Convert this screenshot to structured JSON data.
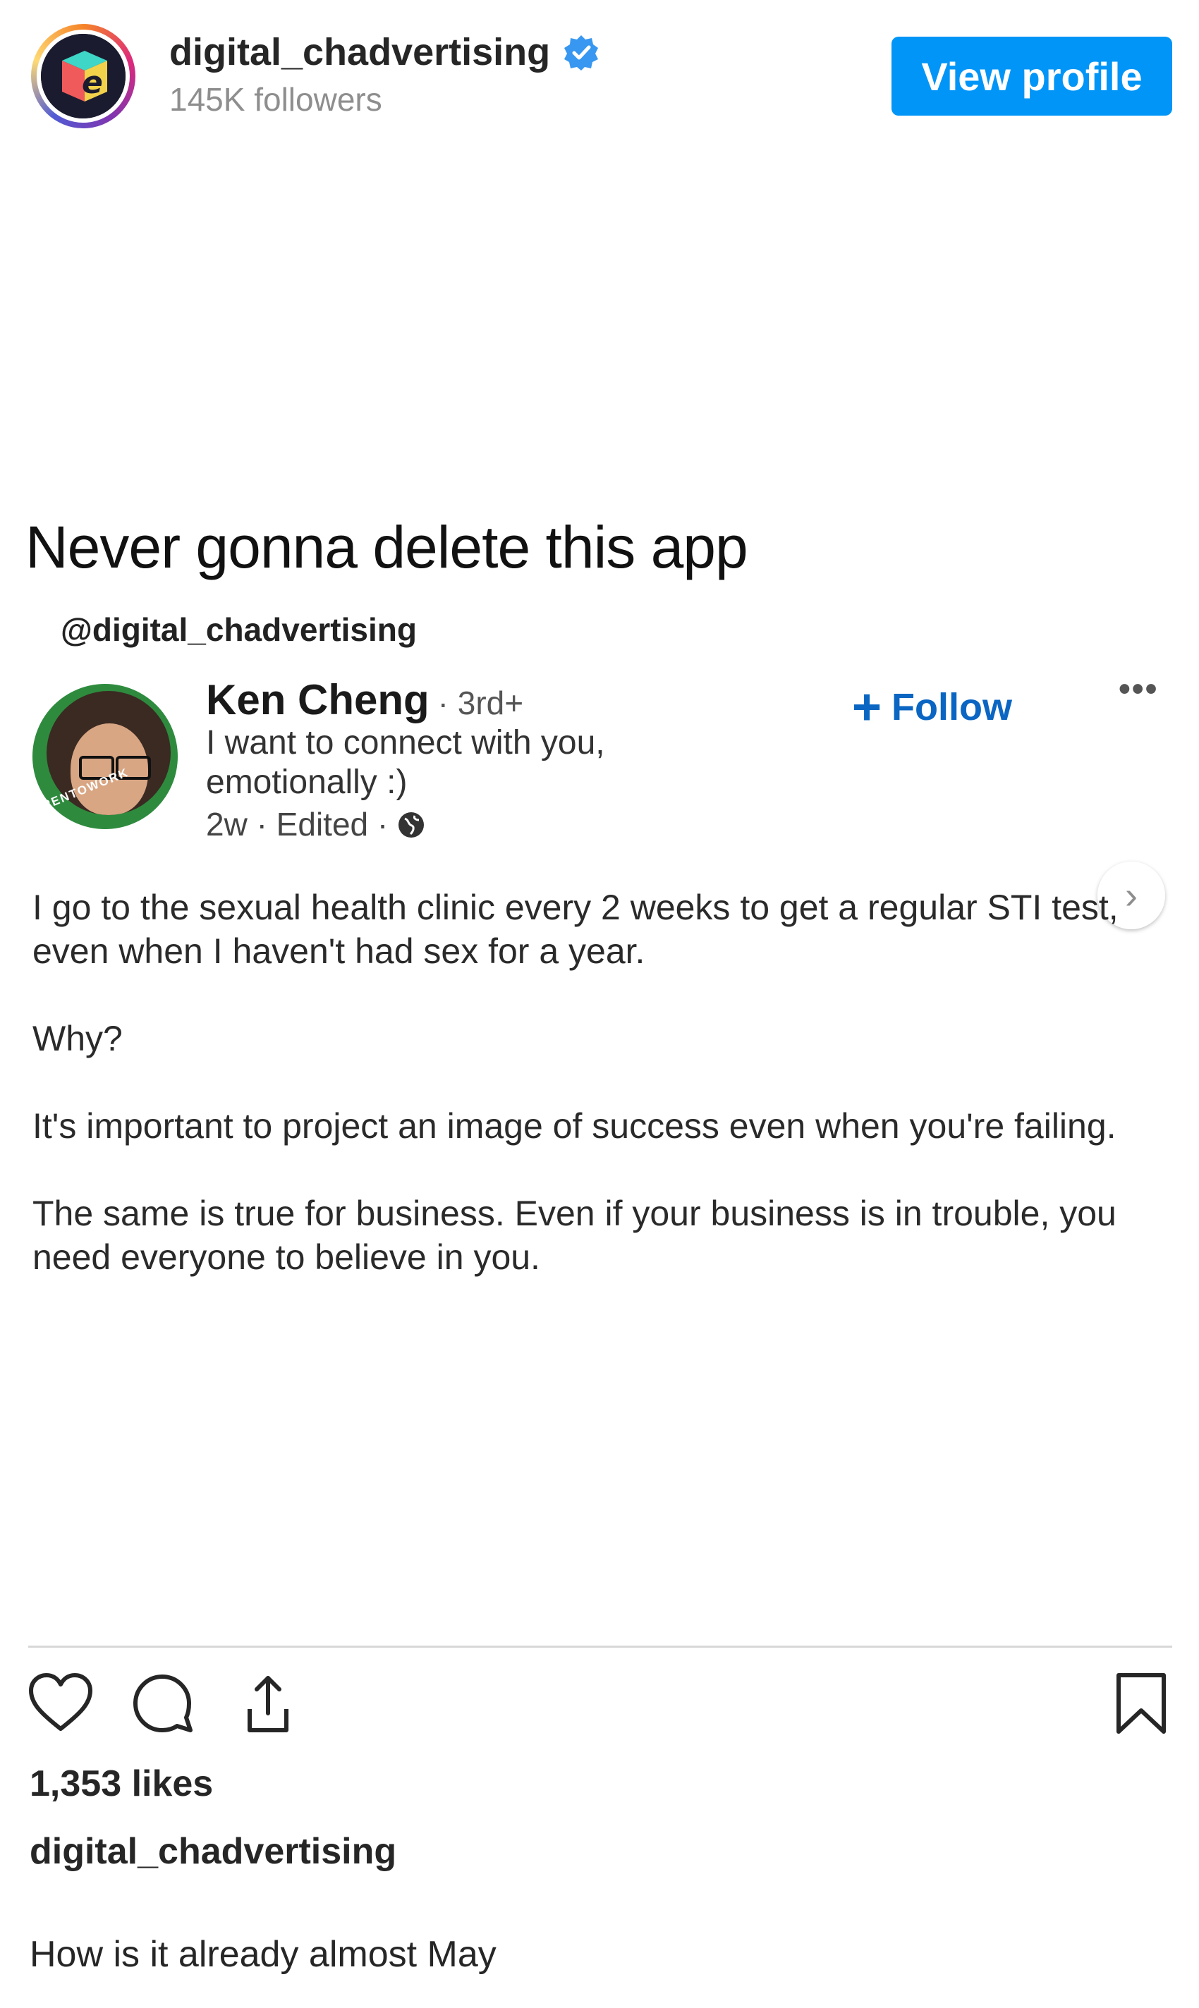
{
  "header": {
    "account_name": "digital_chadvertising",
    "followers": "145K followers",
    "view_profile_label": "View profile"
  },
  "meme": {
    "title": "Never gonna delete this app",
    "handle": "@digital_chadvertising",
    "post": {
      "author_name": "Ken Cheng",
      "degree": "· 3rd+",
      "headline_line1": "I want to connect with you,",
      "headline_line2": "emotionally :)",
      "meta": "2w · Edited ·",
      "follow_label": "Follow",
      "more": "•••",
      "avatar_badge": "#OPENTOWORK",
      "body": [
        "I go to the sexual health clinic every 2 weeks to get a regular STI test, even when I haven't had sex for a year.",
        "Why?",
        "It's important to project an image of success even when you're failing.",
        "The same is true for business. Even if your business is in trouble, you need everyone to believe in you."
      ]
    }
  },
  "footer": {
    "likes": "1,353 likes",
    "caption_user": "digital_chadvertising",
    "caption_text": "How is it already almost May"
  },
  "colors": {
    "instagram_blue": "#0095f6",
    "linkedin_blue": "#0a66c2",
    "verified_blue": "#3897f0",
    "muted_text": "#8e8e8e"
  },
  "icons": [
    "verified-badge-icon",
    "globe-icon",
    "plus-icon",
    "more-icon",
    "next-arrow-icon",
    "heart-icon",
    "comment-icon",
    "share-icon",
    "bookmark-icon"
  ]
}
